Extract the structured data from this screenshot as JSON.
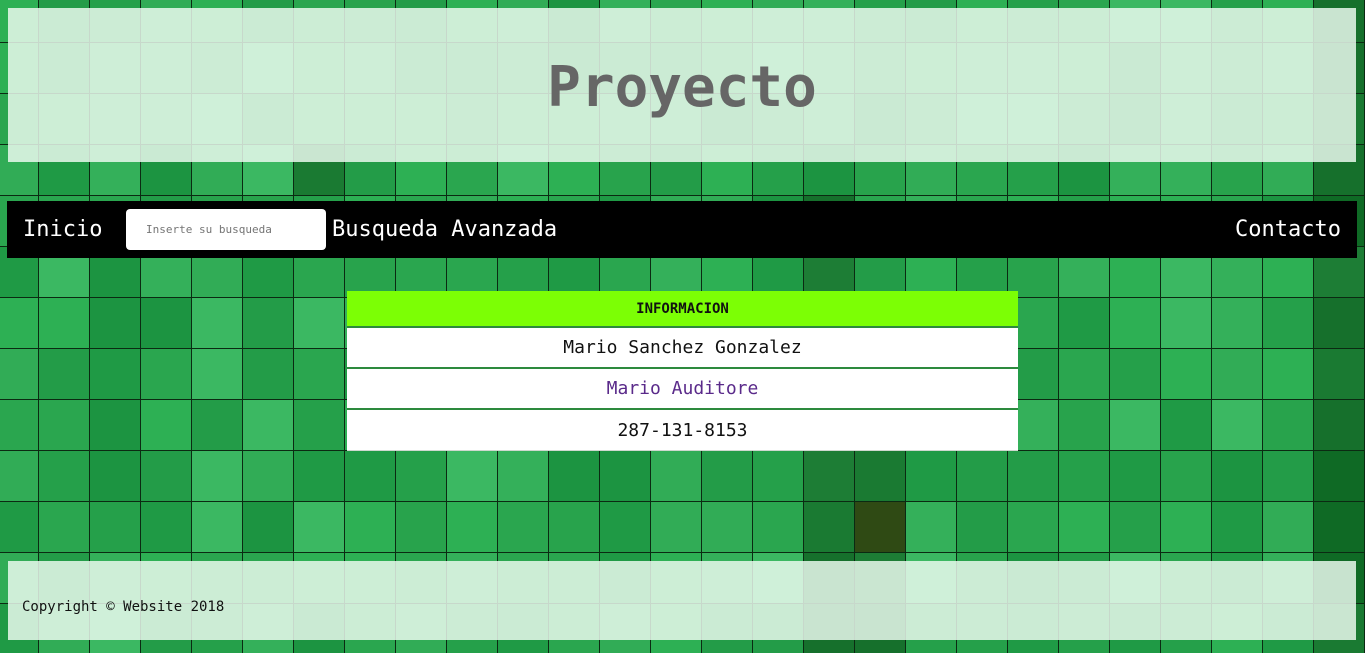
{
  "header": {
    "title": "Proyecto"
  },
  "nav": {
    "home_label": "Inicio",
    "search_placeholder": "Inserte su busqueda",
    "advanced_label": "Busqueda Avanzada",
    "contact_label": "Contacto"
  },
  "info": {
    "heading": "INFORMACION",
    "rows": [
      "Mario Sanchez Gonzalez",
      "Mario Auditore",
      "287-131-8153"
    ]
  },
  "footer": {
    "copyright": "Copyright © Website 2018"
  },
  "colors": {
    "background_green": "#27a24d",
    "nav_bg": "#000000",
    "info_head_bg": "#7cff05",
    "link_purple": "#5a2a8a",
    "title_gray": "#666666"
  }
}
